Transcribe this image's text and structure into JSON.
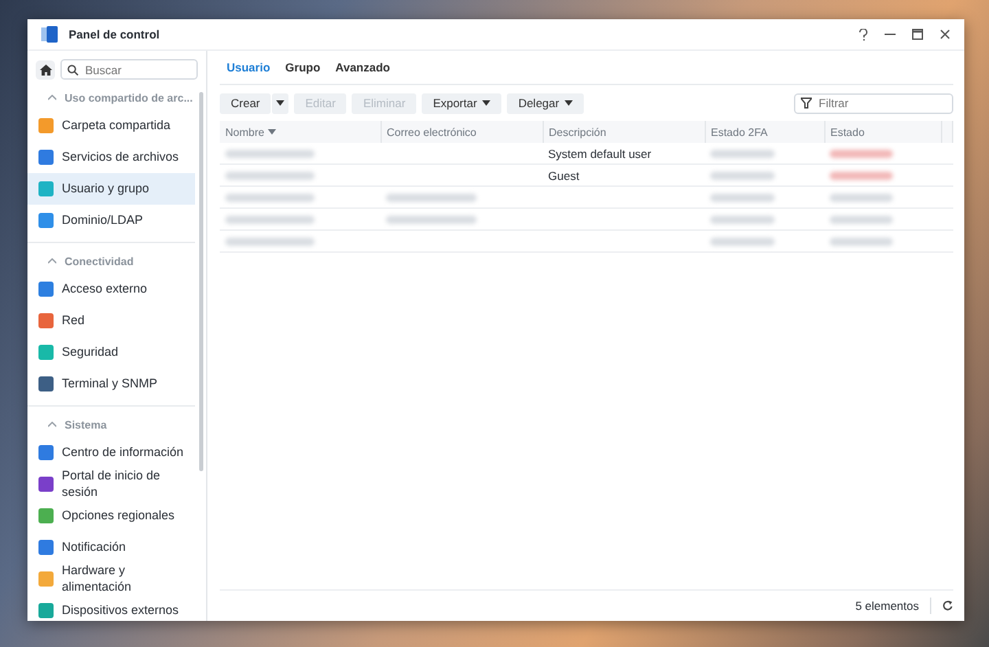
{
  "window": {
    "title": "Panel de control"
  },
  "sidebar": {
    "search": {
      "placeholder": "Buscar"
    },
    "sections": [
      {
        "title": "Uso compartido de arc...",
        "expanded": true,
        "items": [
          {
            "label": "Carpeta compartida",
            "selected": false,
            "color": "#f39a2b"
          },
          {
            "label": "Servicios de archivos",
            "selected": false,
            "color": "#2f7be0"
          },
          {
            "label": "Usuario y grupo",
            "selected": true,
            "color": "#1fb3c4"
          },
          {
            "label": "Dominio/LDAP",
            "selected": false,
            "color": "#2f8fe8"
          }
        ]
      },
      {
        "title": "Conectividad",
        "expanded": true,
        "items": [
          {
            "label": "Acceso externo",
            "selected": false,
            "color": "#2d7fe0"
          },
          {
            "label": "Red",
            "selected": false,
            "color": "#e8653d"
          },
          {
            "label": "Seguridad",
            "selected": false,
            "color": "#19b9a8"
          },
          {
            "label": "Terminal y SNMP",
            "selected": false,
            "color": "#3d5f85"
          }
        ]
      },
      {
        "title": "Sistema",
        "expanded": true,
        "items": [
          {
            "label": "Centro de información",
            "selected": false,
            "color": "#2f7be0"
          },
          {
            "label": "Portal de inicio de sesión",
            "selected": false,
            "color": "#7a3fc9"
          },
          {
            "label": "Opciones regionales",
            "selected": false,
            "color": "#4caf50"
          },
          {
            "label": "Notificación",
            "selected": false,
            "color": "#2f7be0"
          },
          {
            "label": "Hardware y alimentación",
            "selected": false,
            "color": "#f3a93b"
          },
          {
            "label": "Dispositivos externos",
            "selected": false,
            "color": "#18a99a"
          }
        ]
      }
    ]
  },
  "tabs": [
    {
      "label": "Usuario",
      "selected": true
    },
    {
      "label": "Grupo",
      "selected": false
    },
    {
      "label": "Avanzado",
      "selected": false
    }
  ],
  "toolbar": {
    "buttons": [
      {
        "label": "Crear",
        "kind": "split",
        "disabled": false
      },
      {
        "label": "Editar",
        "kind": "plain",
        "disabled": true
      },
      {
        "label": "Eliminar",
        "kind": "plain",
        "disabled": true
      },
      {
        "label": "Exportar",
        "kind": "menu",
        "disabled": false
      },
      {
        "label": "Delegar",
        "kind": "menu",
        "disabled": false
      }
    ],
    "filter": {
      "placeholder": "Filtrar"
    }
  },
  "table": {
    "columns": [
      {
        "label": "Nombre",
        "sorted": true
      },
      {
        "label": "Correo electrónico",
        "sorted": false
      },
      {
        "label": "Descripción",
        "sorted": false
      },
      {
        "label": "Estado 2FA",
        "sorted": false
      },
      {
        "label": "Estado",
        "sorted": false
      }
    ],
    "rows": [
      [
        {
          "kind": "blurred"
        },
        {
          "kind": "empty"
        },
        {
          "kind": "text",
          "text": "System default user"
        },
        {
          "kind": "blurred"
        },
        {
          "kind": "blurred-alert"
        }
      ],
      [
        {
          "kind": "blurred"
        },
        {
          "kind": "empty"
        },
        {
          "kind": "text",
          "text": "Guest"
        },
        {
          "kind": "blurred"
        },
        {
          "kind": "blurred-alert"
        }
      ],
      [
        {
          "kind": "blurred"
        },
        {
          "kind": "blurred"
        },
        {
          "kind": "empty"
        },
        {
          "kind": "blurred"
        },
        {
          "kind": "blurred"
        }
      ],
      [
        {
          "kind": "blurred"
        },
        {
          "kind": "blurred"
        },
        {
          "kind": "empty"
        },
        {
          "kind": "blurred"
        },
        {
          "kind": "blurred"
        }
      ],
      [
        {
          "kind": "blurred"
        },
        {
          "kind": "empty"
        },
        {
          "kind": "empty"
        },
        {
          "kind": "blurred"
        },
        {
          "kind": "blurred"
        }
      ]
    ]
  },
  "status_bar": {
    "count": "5 elementos"
  }
}
